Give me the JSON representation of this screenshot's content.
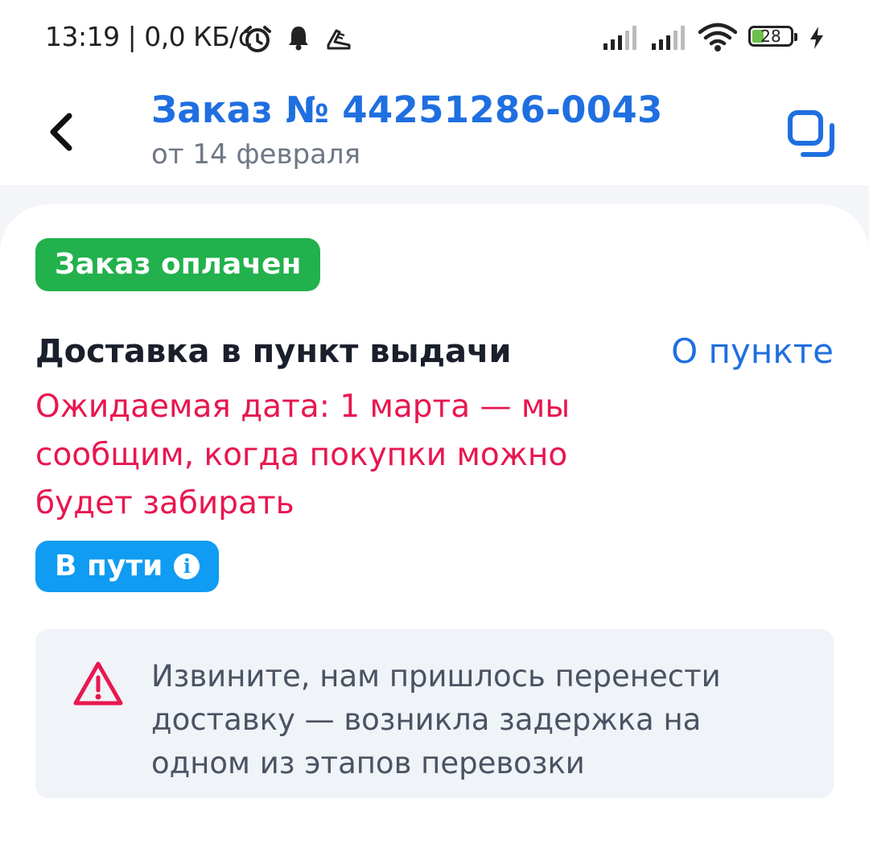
{
  "status_bar": {
    "time_speed": "13:19 | 0,0 КБ/с",
    "battery": "28",
    "icons": [
      "alarm-icon",
      "bell-icon",
      "sneaker-icon",
      "signal-icon",
      "signal-icon",
      "wifi-icon",
      "battery-icon",
      "charging-icon"
    ]
  },
  "header": {
    "title": "Заказ № 44251286-0043",
    "subtitle": "от 14 февраля",
    "icons": [
      "back-icon",
      "copy-icon"
    ]
  },
  "order": {
    "paid_badge": "Заказ оплачен",
    "delivery_title": "Доставка в пункт выдачи",
    "point_link": "О пункте",
    "expected_text": "Ожидаемая дата: 1 марта — мы сообщим, когда покупки можно будет забирать",
    "status_badge": "В пути",
    "notice_text": "Извините, нам пришлось перенести доставку — возникла задержка на одном из этапов перевозки"
  },
  "colors": {
    "accent_blue": "#1f6fe0",
    "paid_green": "#22b14c",
    "alert_red": "#e8174f",
    "transit_blue": "#109cf2"
  }
}
